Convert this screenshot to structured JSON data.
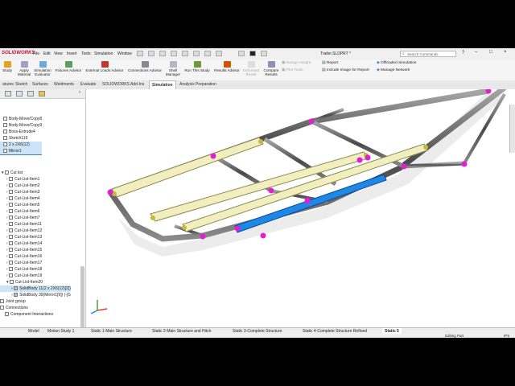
{
  "app": {
    "logo": "SOLIDWORKS",
    "document_title": "Trailer.SLDPRT *",
    "menus": [
      "File",
      "Edit",
      "View",
      "Insert",
      "Tools",
      "Simulation",
      "Window"
    ],
    "search_placeholder": "Search Commands"
  },
  "commands": [
    {
      "label": "Study",
      "sub": ""
    },
    {
      "label": "Apply",
      "sub": "Material"
    },
    {
      "label": "Simulation",
      "sub": "Evaluator"
    },
    {
      "label": "Fixtures Advisor",
      "sub": ""
    },
    {
      "label": "External Loads Advisor",
      "sub": ""
    },
    {
      "label": "Connections Advisor",
      "sub": ""
    },
    {
      "label": "Shell",
      "sub": "Manager"
    },
    {
      "label": "Run This Study",
      "sub": ""
    },
    {
      "label": "Results Advisor",
      "sub": ""
    },
    {
      "label": "Deformed",
      "sub": "Result"
    },
    {
      "label": "Compare",
      "sub": "Results"
    },
    {
      "label": "Design Insight",
      "sub": ""
    },
    {
      "label": "Plot Tools",
      "sub": ""
    },
    {
      "label": "Report",
      "sub": ""
    },
    {
      "label": "Include Image for Report",
      "sub": ""
    },
    {
      "label": "Offloaded Simulation",
      "sub": ""
    },
    {
      "label": "Manage Network",
      "sub": ""
    }
  ],
  "tabs": [
    "atures",
    "Sketch",
    "Surfaces",
    "Weldments",
    "Evaluate",
    "SOLIDWORKS Add-Ins",
    "Simulation",
    "Analysis Preparation"
  ],
  "active_tab": "Simulation",
  "tree_top": [
    "Body-Move/Copy8",
    "Body-Move/Copy9",
    "Boss-Extrude4",
    "Sketch119",
    "2 x 2X6(12)",
    "Mirror1"
  ],
  "cutlist_header": "Cut list",
  "cutlist_items": [
    "Cut-List-Item1",
    "Cut-List-Item2",
    "Cut-List-Item3",
    "Cut-List-Item4",
    "Cut-List-Item5",
    "Cut-List-Item6",
    "Cut-List-Item7",
    "Cut-List-Item11",
    "Cut-List-Item12",
    "Cut-List-Item13",
    "Cut-List-Item14",
    "Cut-List-Item15",
    "Cut-List-Item16",
    "Cut-List-Item17",
    "Cut-List-Item18",
    "Cut-List-Item19",
    "Cut-List-Item20"
  ],
  "solid_bodies": [
    "SolidBody 11(2 x 2X6(12)[2])",
    "SolidBody 39(Mirror1[9]) (-[S"
  ],
  "tree_bottom": [
    "Joint group",
    "Connections",
    "Component Interactions"
  ],
  "bottom_tabs": [
    "Model",
    "Motion Study 1",
    "Static 1-Main Structure",
    "Static 2-Main Structure and Hitch",
    "Static 3-Complete Structure",
    "Static 4-Complete Structure Refined",
    "Static 5"
  ],
  "active_bottom_tab": "Static 5",
  "status_text": "Editing Part",
  "status_right": "IPS",
  "colors": {
    "accent": "#c8102e",
    "selection": "#cde3f7",
    "beam_blue": "#1e88e5",
    "joint": "#e020d0",
    "wood": "#f3eebf"
  }
}
